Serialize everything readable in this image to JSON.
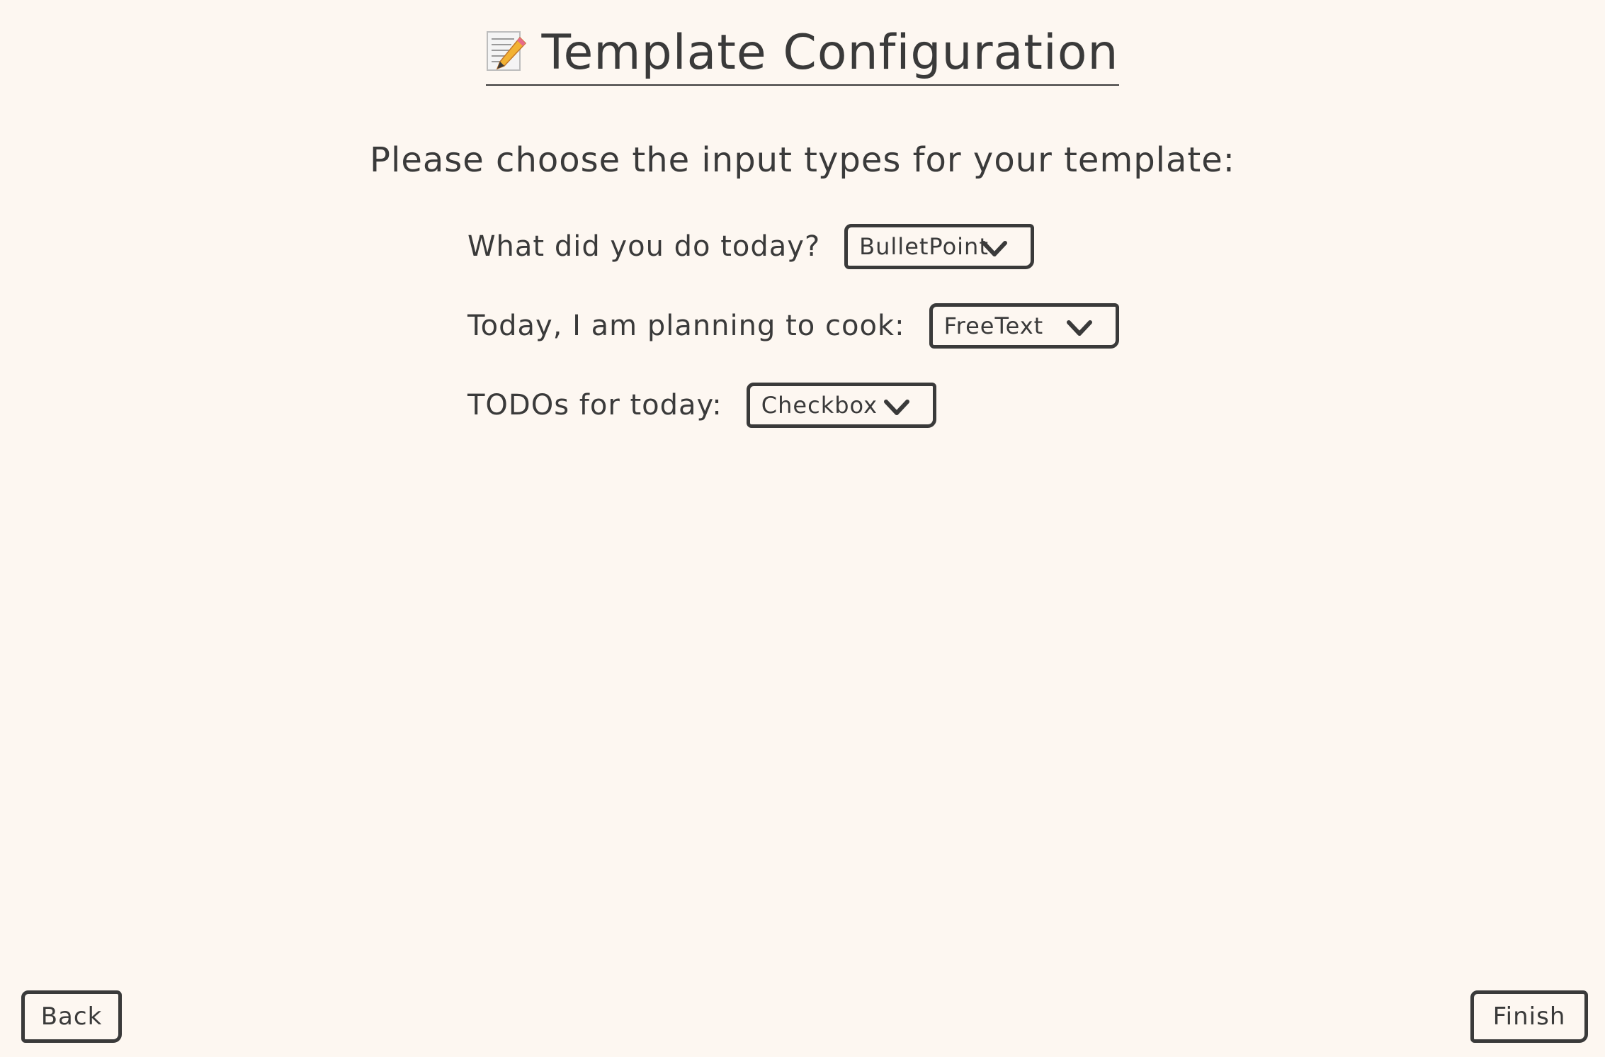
{
  "header": {
    "title": "Template Configuration",
    "icon": "memo-icon"
  },
  "subtitle": "Please choose the input types for your template:",
  "fields": [
    {
      "label": "What did you do today?",
      "selected": "BulletPoint"
    },
    {
      "label": "Today, I am planning to cook:",
      "selected": "FreeText"
    },
    {
      "label": "TODOs for today:",
      "selected": "Checkbox"
    }
  ],
  "footer": {
    "back_label": "Back",
    "finish_label": "Finish"
  },
  "colors": {
    "background": "#fdf7f1",
    "ink": "#3a3a3a"
  }
}
